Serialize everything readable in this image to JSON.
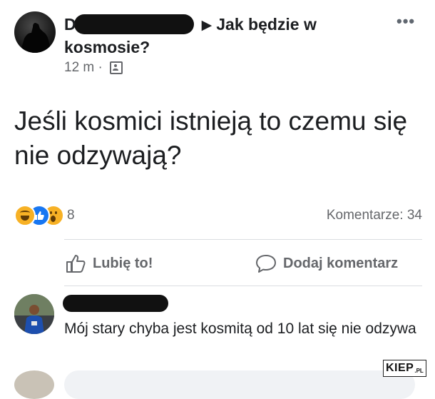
{
  "post": {
    "author": "D",
    "arrow": "▶",
    "group": "Jak będzie w kosmosie?",
    "time": "12 m",
    "separator": "·",
    "menu_icon": "more-dots-icon",
    "privacy_icon": "group-privacy-icon",
    "text": "Jeśli kosmici istnieją to czemu się nie odzywają?"
  },
  "reactions": {
    "icons": [
      "haha-reaction-icon",
      "like-reaction-icon",
      "wow-reaction-icon"
    ],
    "count": "8",
    "comments_label": "Komentarze: 34"
  },
  "actions": {
    "like_label": "Lubię to!",
    "like_icon": "thumbs-up-icon",
    "comment_label": "Dodaj komentarz",
    "comment_icon": "comment-bubble-icon"
  },
  "comment": {
    "text": "Mój stary chyba jest kosmitą od 10 lat się nie odzywa"
  },
  "watermark": {
    "main": "KIEP",
    "sub": ".PL"
  },
  "colors": {
    "text": "#1c1e21",
    "secondary": "#65676b",
    "like_blue": "#1877f2",
    "reaction_yellow": "#f7b125",
    "divider": "#dadde1",
    "input_bg": "#f0f2f5"
  }
}
